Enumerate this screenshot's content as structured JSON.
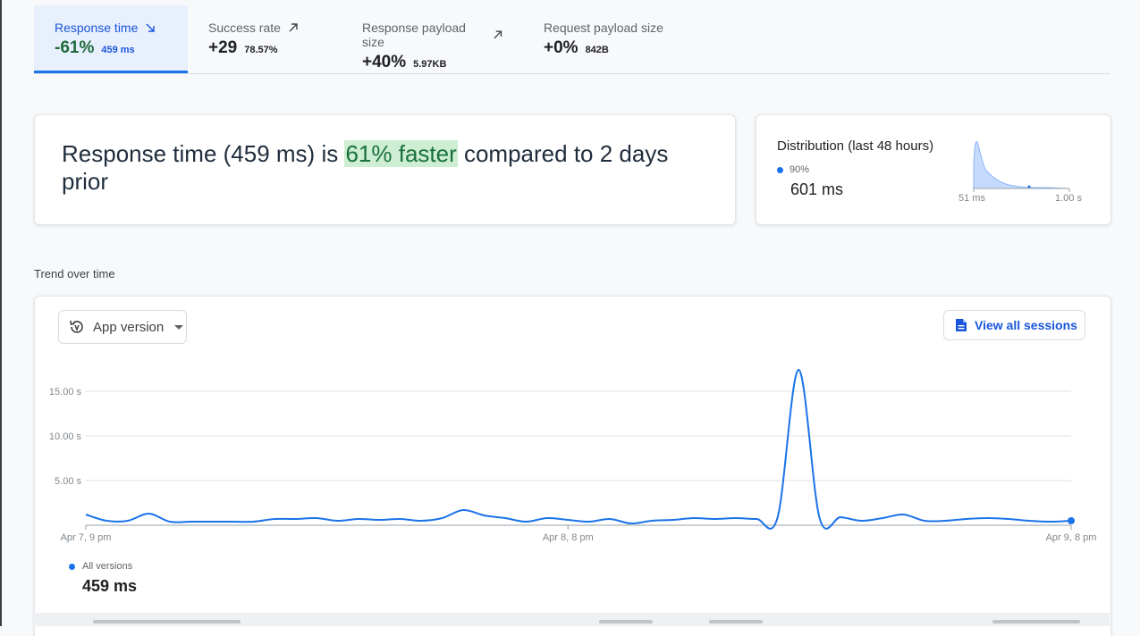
{
  "tabs": [
    {
      "label": "Response time",
      "delta": "-61%",
      "value": "459 ms",
      "trend": "down",
      "active": true
    },
    {
      "label": "Success rate",
      "delta": "+29",
      "value": "78.57%",
      "trend": "up",
      "active": false
    },
    {
      "label": "Response payload size",
      "delta": "+40%",
      "value": "5.97KB",
      "trend": "up",
      "active": false
    },
    {
      "label": "Request payload size",
      "delta": "+0%",
      "value": "842B",
      "trend": "none",
      "active": false
    }
  ],
  "summary": {
    "prefix": "Response time (459 ms) is ",
    "highlight": "61% faster",
    "suffix": " compared to 2 days prior"
  },
  "distribution": {
    "title": "Distribution (last 48 hours)",
    "percentile_label": "90%",
    "percentile_value": "601 ms",
    "tick_min": "51 ms",
    "tick_max": "1.00 s"
  },
  "trend": {
    "section_title": "Trend over time",
    "dropdown_label": "App version",
    "view_sessions_label": "View all sessions",
    "legend_label": "All versions",
    "legend_value": "459 ms"
  },
  "colors": {
    "accent": "#1a73e8",
    "positive": "#19703b",
    "highlight_bg": "#cdeed3"
  },
  "icons": {
    "trend_down": "arrow-down-right-icon",
    "trend_up": "arrow-up-right-icon",
    "version": "version-history-icon",
    "document": "document-icon"
  },
  "chart_data": {
    "type": "line",
    "ylim": [
      0,
      17.5
    ],
    "yticks": [
      5,
      10,
      15
    ],
    "ytick_labels": [
      "5.00 s",
      "10.00 s",
      "15.00 s"
    ],
    "xticks_at": [
      0,
      23,
      47
    ],
    "xtick_labels": [
      "Apr 7, 9 pm",
      "Apr 8, 8 pm",
      "Apr 9, 8 pm"
    ],
    "grid": true,
    "series": [
      {
        "name": "All versions",
        "x": [
          0,
          1,
          2,
          3,
          4,
          5,
          6,
          7,
          8,
          9,
          10,
          11,
          12,
          13,
          14,
          15,
          16,
          17,
          18,
          19,
          20,
          21,
          22,
          23,
          24,
          25,
          26,
          27,
          28,
          29,
          30,
          31,
          32,
          33,
          34,
          35,
          36,
          37,
          38,
          39,
          40,
          41,
          42,
          43,
          44,
          45,
          46,
          47
        ],
        "y": [
          1.2,
          0.5,
          0.5,
          1.3,
          0.4,
          0.4,
          0.4,
          0.4,
          0.4,
          0.7,
          0.7,
          0.8,
          0.5,
          0.7,
          0.6,
          0.7,
          0.5,
          0.8,
          1.7,
          1.1,
          0.8,
          0.4,
          0.8,
          0.6,
          0.4,
          0.7,
          0.2,
          0.5,
          0.6,
          0.8,
          0.7,
          0.8,
          0.7,
          0.9,
          17.4,
          0.8,
          0.9,
          0.5,
          0.8,
          1.2,
          0.5,
          0.5,
          0.7,
          0.8,
          0.7,
          0.5,
          0.4,
          0.5
        ]
      }
    ],
    "distribution": {
      "type": "area",
      "x_range_labels": [
        "51 ms",
        "1.00 s"
      ],
      "percentile": "90%",
      "percentile_value": "601 ms"
    }
  }
}
